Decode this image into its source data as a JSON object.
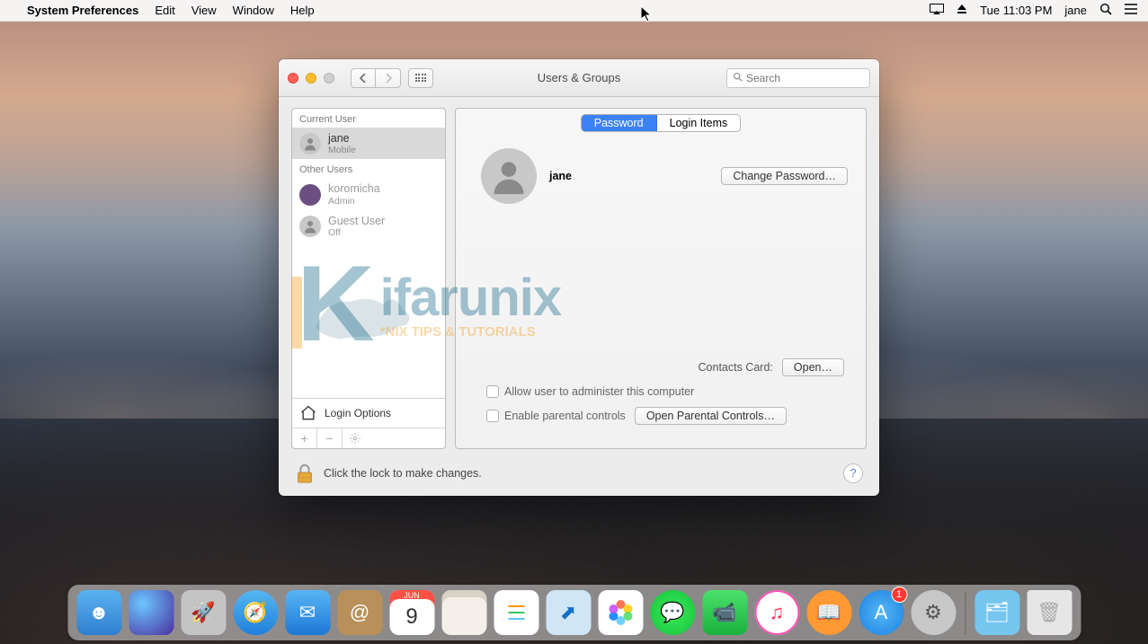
{
  "menubar": {
    "app_name": "System Preferences",
    "items": [
      "Edit",
      "View",
      "Window",
      "Help"
    ],
    "clock": "Tue 11:03 PM",
    "user": "jane"
  },
  "window": {
    "title": "Users & Groups",
    "search_placeholder": "Search"
  },
  "sidebar": {
    "current_label": "Current User",
    "other_label": "Other Users",
    "users": [
      {
        "name": "jane",
        "sub": "Mobile",
        "selected": true
      },
      {
        "name": "koromicha",
        "sub": "Admin",
        "selected": false
      },
      {
        "name": "Guest User",
        "sub": "Off",
        "selected": false
      }
    ],
    "login_options": "Login Options"
  },
  "main": {
    "tabs": {
      "password": "Password",
      "login_items": "Login Items"
    },
    "username": "jane",
    "change_password": "Change Password…",
    "contacts_card_label": "Contacts Card:",
    "open_button": "Open…",
    "admin_checkbox": "Allow user to administer this computer",
    "parental_checkbox": "Enable parental controls",
    "open_parental": "Open Parental Controls…"
  },
  "footer": {
    "lock_text": "Click the lock to make changes."
  },
  "watermark": {
    "big": "ifarunix",
    "sub": "*NIX TIPS & TUTORIALS"
  },
  "dock": {
    "badge": "1",
    "cal_day": "9",
    "cal_mon": "JUN"
  }
}
